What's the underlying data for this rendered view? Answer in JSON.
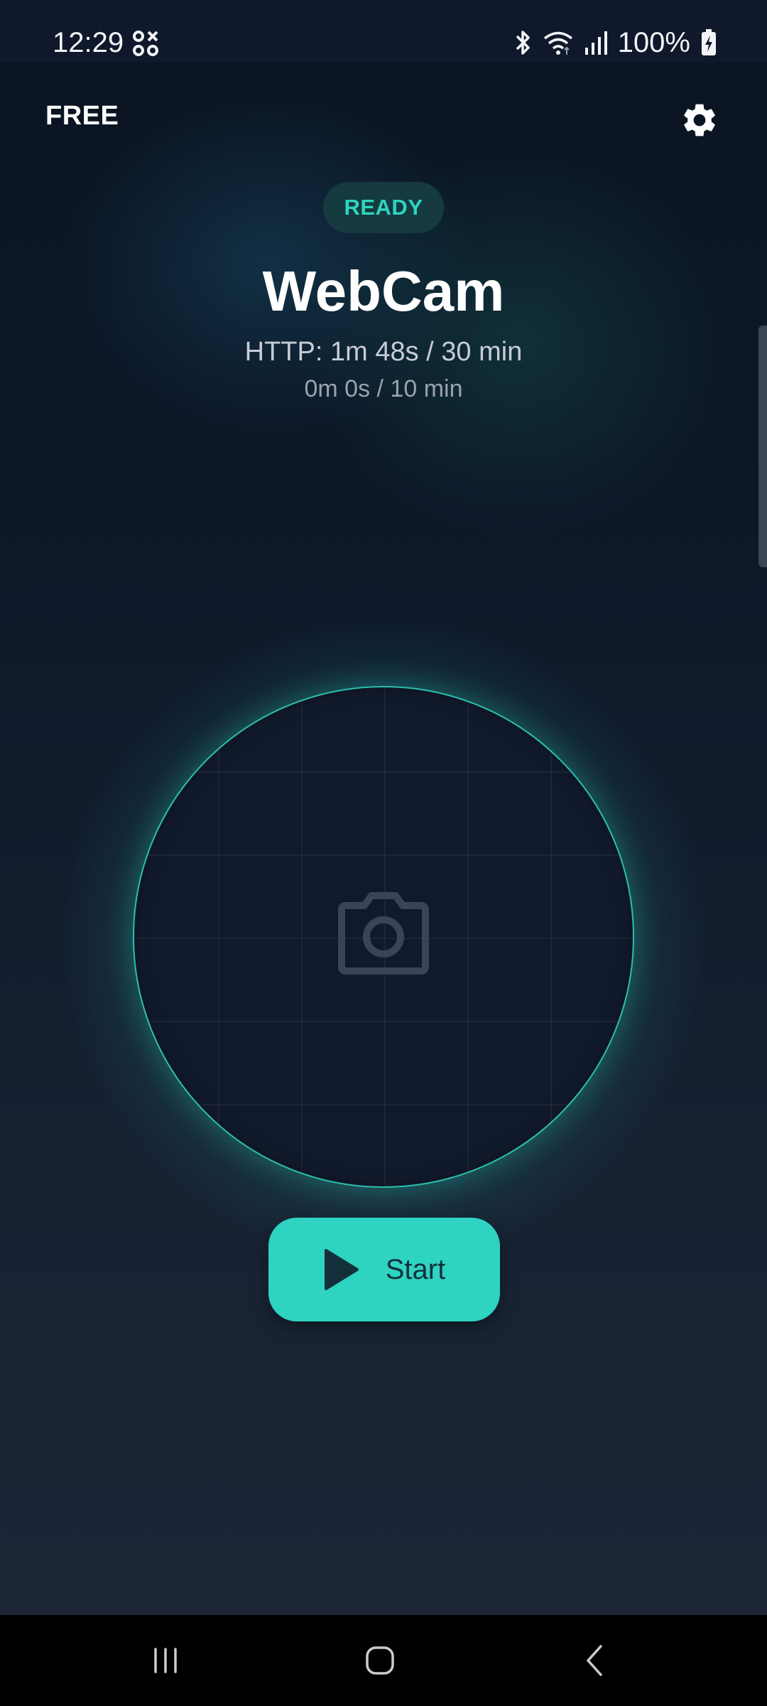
{
  "status_bar": {
    "time": "12:29",
    "battery": "100%",
    "icons": [
      "quad-circle-icon",
      "bluetooth-icon",
      "wifi-icon",
      "signal-icon",
      "battery-charging-icon"
    ]
  },
  "header": {
    "plan": "FREE",
    "settings_icon": "gear-icon"
  },
  "status": {
    "label": "READY"
  },
  "main": {
    "title": "WebCam",
    "http_usage": "HTTP: 1m 48s / 30 min",
    "session_usage": "0m 0s / 10 min",
    "preview_icon": "camera-icon"
  },
  "actions": {
    "start_label": "Start",
    "start_icon": "play-icon"
  },
  "nav": {
    "items": [
      "recents-icon",
      "home-icon",
      "back-icon"
    ]
  },
  "colors": {
    "accent": "#2ed3c1",
    "pill_bg": "#153a3f",
    "background": "#0d1728"
  }
}
